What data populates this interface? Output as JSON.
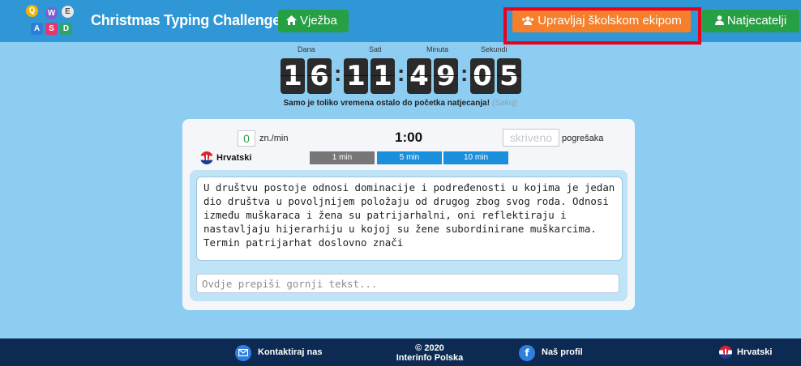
{
  "header": {
    "logo_keys": [
      "Q",
      "W",
      "E",
      "A",
      "S",
      "D"
    ],
    "title": "Christmas Typing Challenge",
    "practice_label": "Vježba",
    "manage_team_label": "Upravljaj školskom ekipom",
    "competitors_label": "Natjecatelji"
  },
  "countdown": {
    "labels": {
      "days": "Dana",
      "hours": "Sati",
      "minutes": "Minuta",
      "seconds": "Sekundi"
    },
    "digits": [
      "1",
      "6",
      "1",
      "1",
      "4",
      "9",
      "0",
      "5"
    ],
    "note": "Samo je toliko vremena ostalo do početka natjecanja!",
    "hide_label": "(Sakrij)"
  },
  "card": {
    "speed_value": "0",
    "speed_unit": "zn./min",
    "timer": "1:00",
    "errors_value": "skriveno",
    "errors_unit": "pogrešaka",
    "language": "Hrvatski",
    "durations": [
      "1 min",
      "5 min",
      "10 min"
    ],
    "source_text": "U društvu postoje odnosi dominacije i podređenosti u kojima je jedan dio društva u povoljnijem položaju od drugog zbog svog roda. Odnosi između muškaraca i žena su patrijarhalni, oni reflektiraju i nastavljaju hijerarhiju u kojoj su žene subordinirane muškarcima. Termin patrijarhat doslovno znači",
    "input_placeholder": "Ovdje prepiši gornji tekst..."
  },
  "footer": {
    "contact": "Kontaktiraj nas",
    "copyright": "© 2020",
    "company": "Interinfo Polska",
    "profile": "Naš profil",
    "language": "Hrvatski"
  },
  "colors": {
    "header_bg": "#2f97d6",
    "page_bg": "#8ecdf2",
    "footer_bg": "#0d2b52",
    "orange": "#f57f2a",
    "green": "#27a045",
    "highlight": "#e8001c"
  }
}
